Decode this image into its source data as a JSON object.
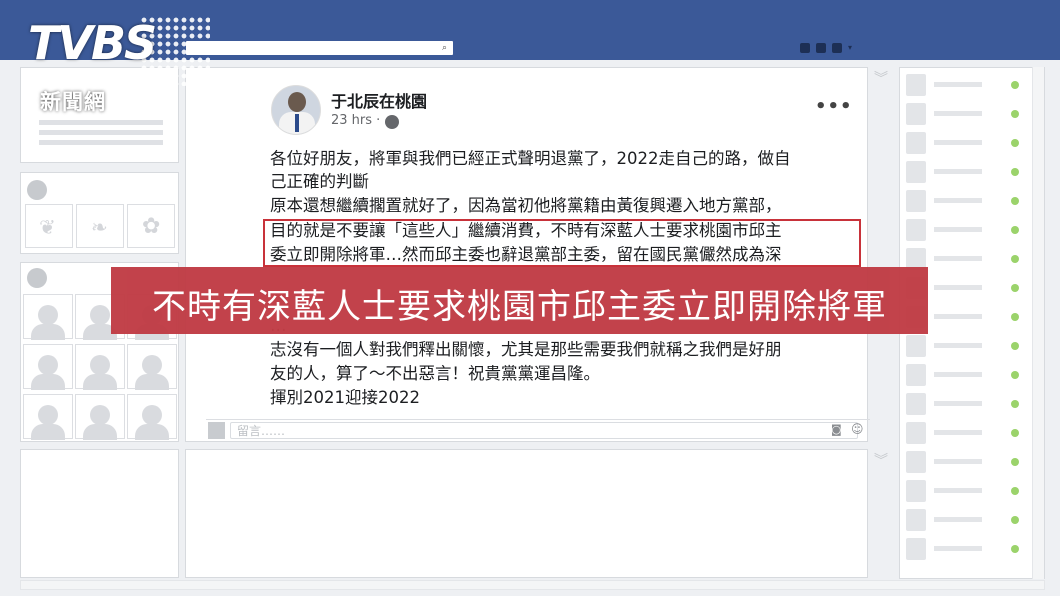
{
  "logo": {
    "brand": "TVBS",
    "subtitle": "新聞網"
  },
  "post": {
    "author": "于北辰在桃園",
    "time": "23 hrs · ",
    "more": "•••",
    "lines": [
      "各位好朋友，將軍與我們已經正式聲明退黨了，2022走自己的路，做自",
      "己正確的判斷",
      "原本還想繼續擱置就好了，因為當初他將黨籍由黃復興遷入地方黨部，",
      "目的就是不要讓「這些人」繼續消費，不時有深藍人士要求桃園市邱主",
      "委立即開除將軍…然而邱主委也辭退黨部主委，留在國民黨儼然成為深",
      "…",
      "志沒有一個人對我們釋出關懷，尤其是那些需要我們就稱之我們是好朋",
      "友的人，算了～不出惡言！祝貴黨黨運昌隆。",
      "揮別2021迎接2022"
    ],
    "comment_placeholder": "留言……"
  },
  "caption": "不時有深藍人士要求桃園市邱主委立即開除將軍",
  "icons": {
    "search": "search-icon",
    "globe": "globe-icon",
    "camera": "camera-icon",
    "emoji": "emoji-icon"
  },
  "colors": {
    "topbar": "#3b5998",
    "caption_bg": "#c03b44",
    "highlight_border": "#c8323a",
    "online_dot": "#9bd36b"
  }
}
